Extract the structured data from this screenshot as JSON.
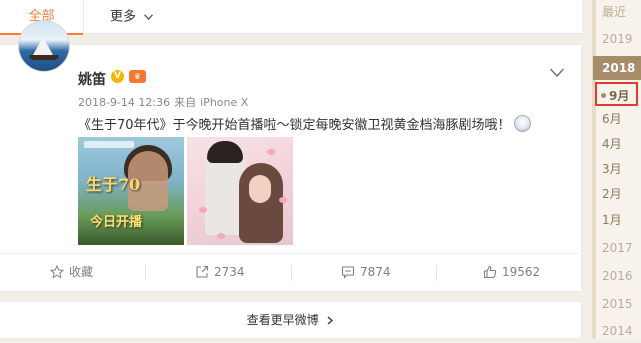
{
  "tabs": {
    "all_label": "全部",
    "more_label": "更多"
  },
  "post": {
    "username": "姚笛",
    "verified_badge": "V",
    "member_badge": "会员",
    "timestamp": "2018-9-14 12:36",
    "source_prefix": "来自",
    "source": "iPhone X",
    "text": "《生于70年代》于今晚开始首播啦～锁定每晚安徽卫视黄金档海豚剧场哦！",
    "image1_title": "生于70",
    "image1_subtitle": "今日开播",
    "actions": {
      "favorite_label": "收藏",
      "repost_count": "2734",
      "comment_count": "7874",
      "like_count": "19562"
    }
  },
  "footer": {
    "more_label": "查看更早微博"
  },
  "timeline": {
    "items": [
      "最近",
      "2019",
      "2018",
      "9月",
      "6月",
      "4月",
      "3月",
      "2月",
      "1月",
      "2017",
      "2016",
      "2015",
      "2014"
    ],
    "active_year": "2018",
    "active_month": "9月"
  },
  "colors": {
    "accent": "#fa7d3c",
    "timeline_active": "#a78c6a",
    "highlight_box": "#e23c2c"
  }
}
